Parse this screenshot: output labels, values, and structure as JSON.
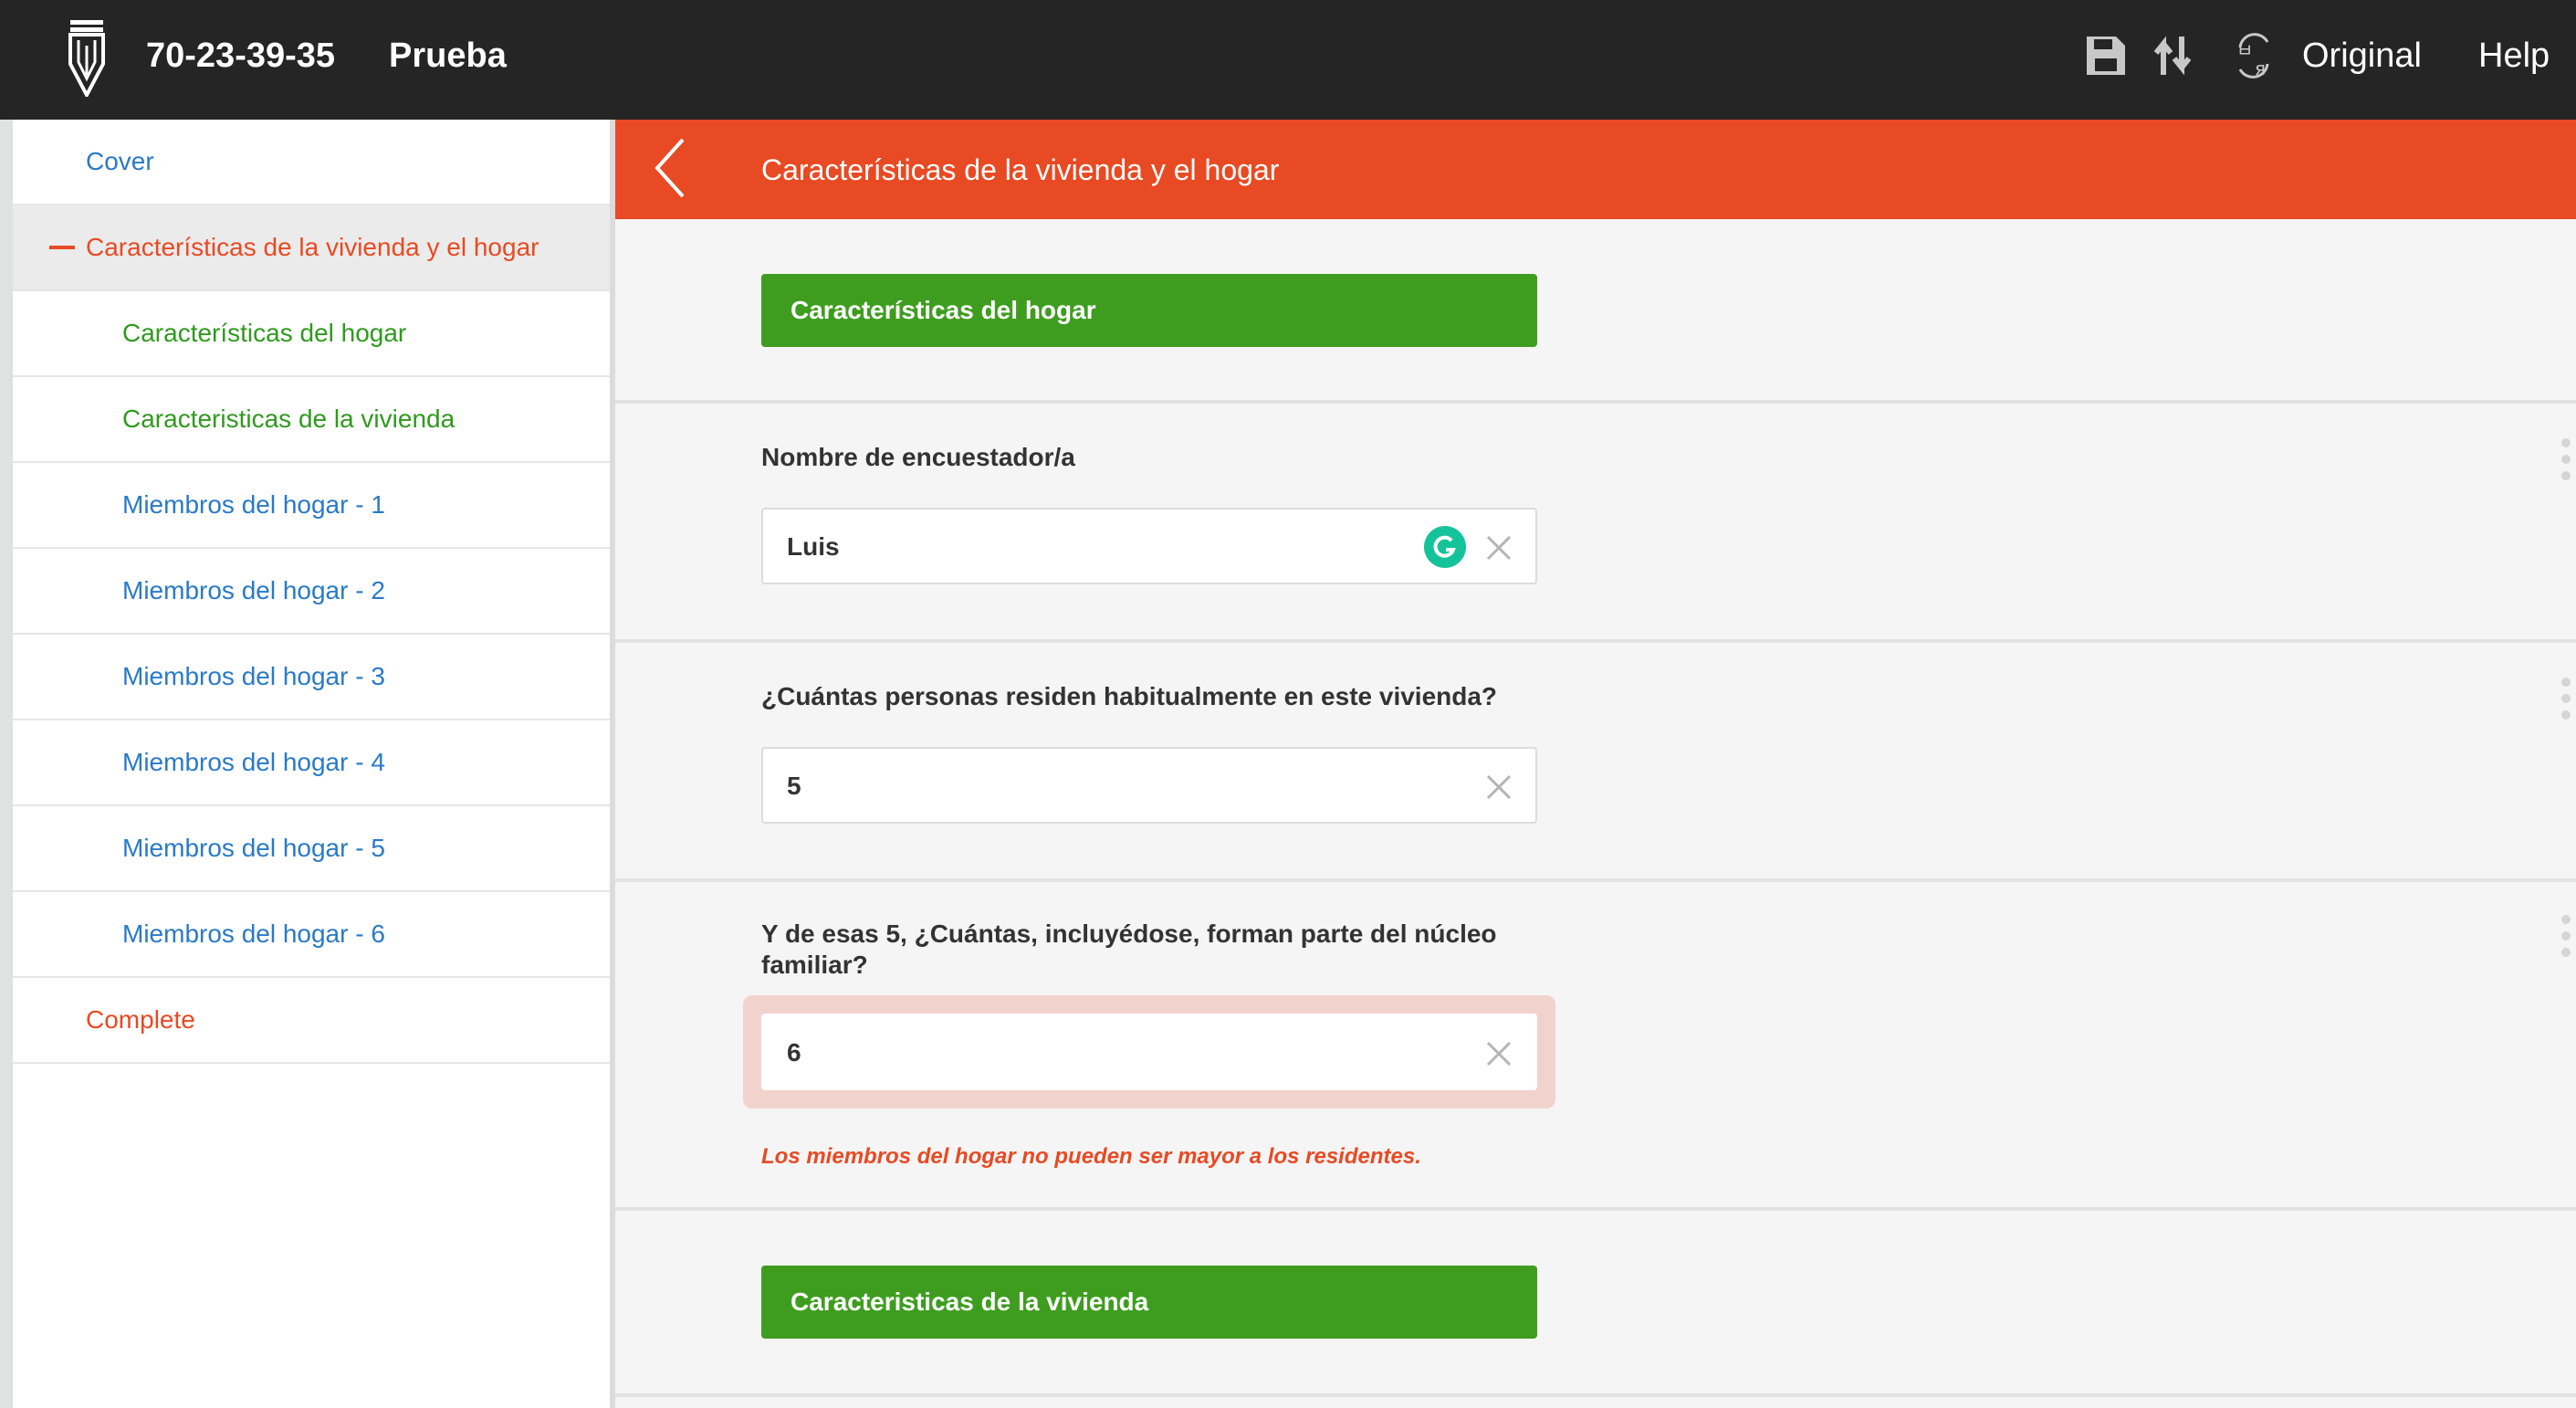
{
  "topbar": {
    "logo_icon": "pencil-logo-icon",
    "interview_id": "70-23-39-35",
    "questionnaire_title": "Prueba",
    "save_icon": "save-icon",
    "sort_icon": "sort-icon",
    "translate_icon": "translate-icon",
    "language": "Original",
    "help": "Help"
  },
  "sidebar": {
    "items": [
      {
        "label": "Cover",
        "color": "blue",
        "level": 0
      },
      {
        "label": "Características de la vivienda y el hogar",
        "color": "orange",
        "level": 0,
        "active": true
      },
      {
        "label": "Características del hogar",
        "color": "green",
        "level": 1
      },
      {
        "label": "Caracteristicas de la vivienda",
        "color": "green",
        "level": 1
      },
      {
        "label": "Miembros del hogar - 1",
        "color": "blue",
        "level": 1
      },
      {
        "label": "Miembros del hogar - 2",
        "color": "blue",
        "level": 1
      },
      {
        "label": "Miembros del hogar - 3",
        "color": "blue",
        "level": 1
      },
      {
        "label": "Miembros del hogar - 4",
        "color": "blue",
        "level": 1
      },
      {
        "label": "Miembros del hogar - 5",
        "color": "blue",
        "level": 1
      },
      {
        "label": "Miembros del hogar - 6",
        "color": "blue",
        "level": 1
      },
      {
        "label": "Complete",
        "color": "orange",
        "level": 0
      }
    ]
  },
  "section": {
    "title": "Características de la vivienda y el hogar"
  },
  "main": {
    "group1": "Características del hogar",
    "q1": {
      "label": "Nombre de encuestador/a",
      "value": "Luis"
    },
    "q2": {
      "label": "¿Cuántas personas residen habitualmente en este vivienda?",
      "value": "5"
    },
    "q3": {
      "label": "Y de esas 5, ¿Cuántas, incluyédose, forman parte del núcleo familiar?",
      "value": "6",
      "error": "Los miembros del hogar no pueden ser mayor a los residentes."
    },
    "group2": "Caracteristicas de la vivienda"
  },
  "colors": {
    "topbar": "#252525",
    "accent_orange": "#e84a23",
    "group_green": "#3e9d1f",
    "link_blue": "#2a7ac7",
    "link_green": "#2f9a1e",
    "error_bg": "#f2d2cd",
    "grammarly": "#15c39a"
  }
}
